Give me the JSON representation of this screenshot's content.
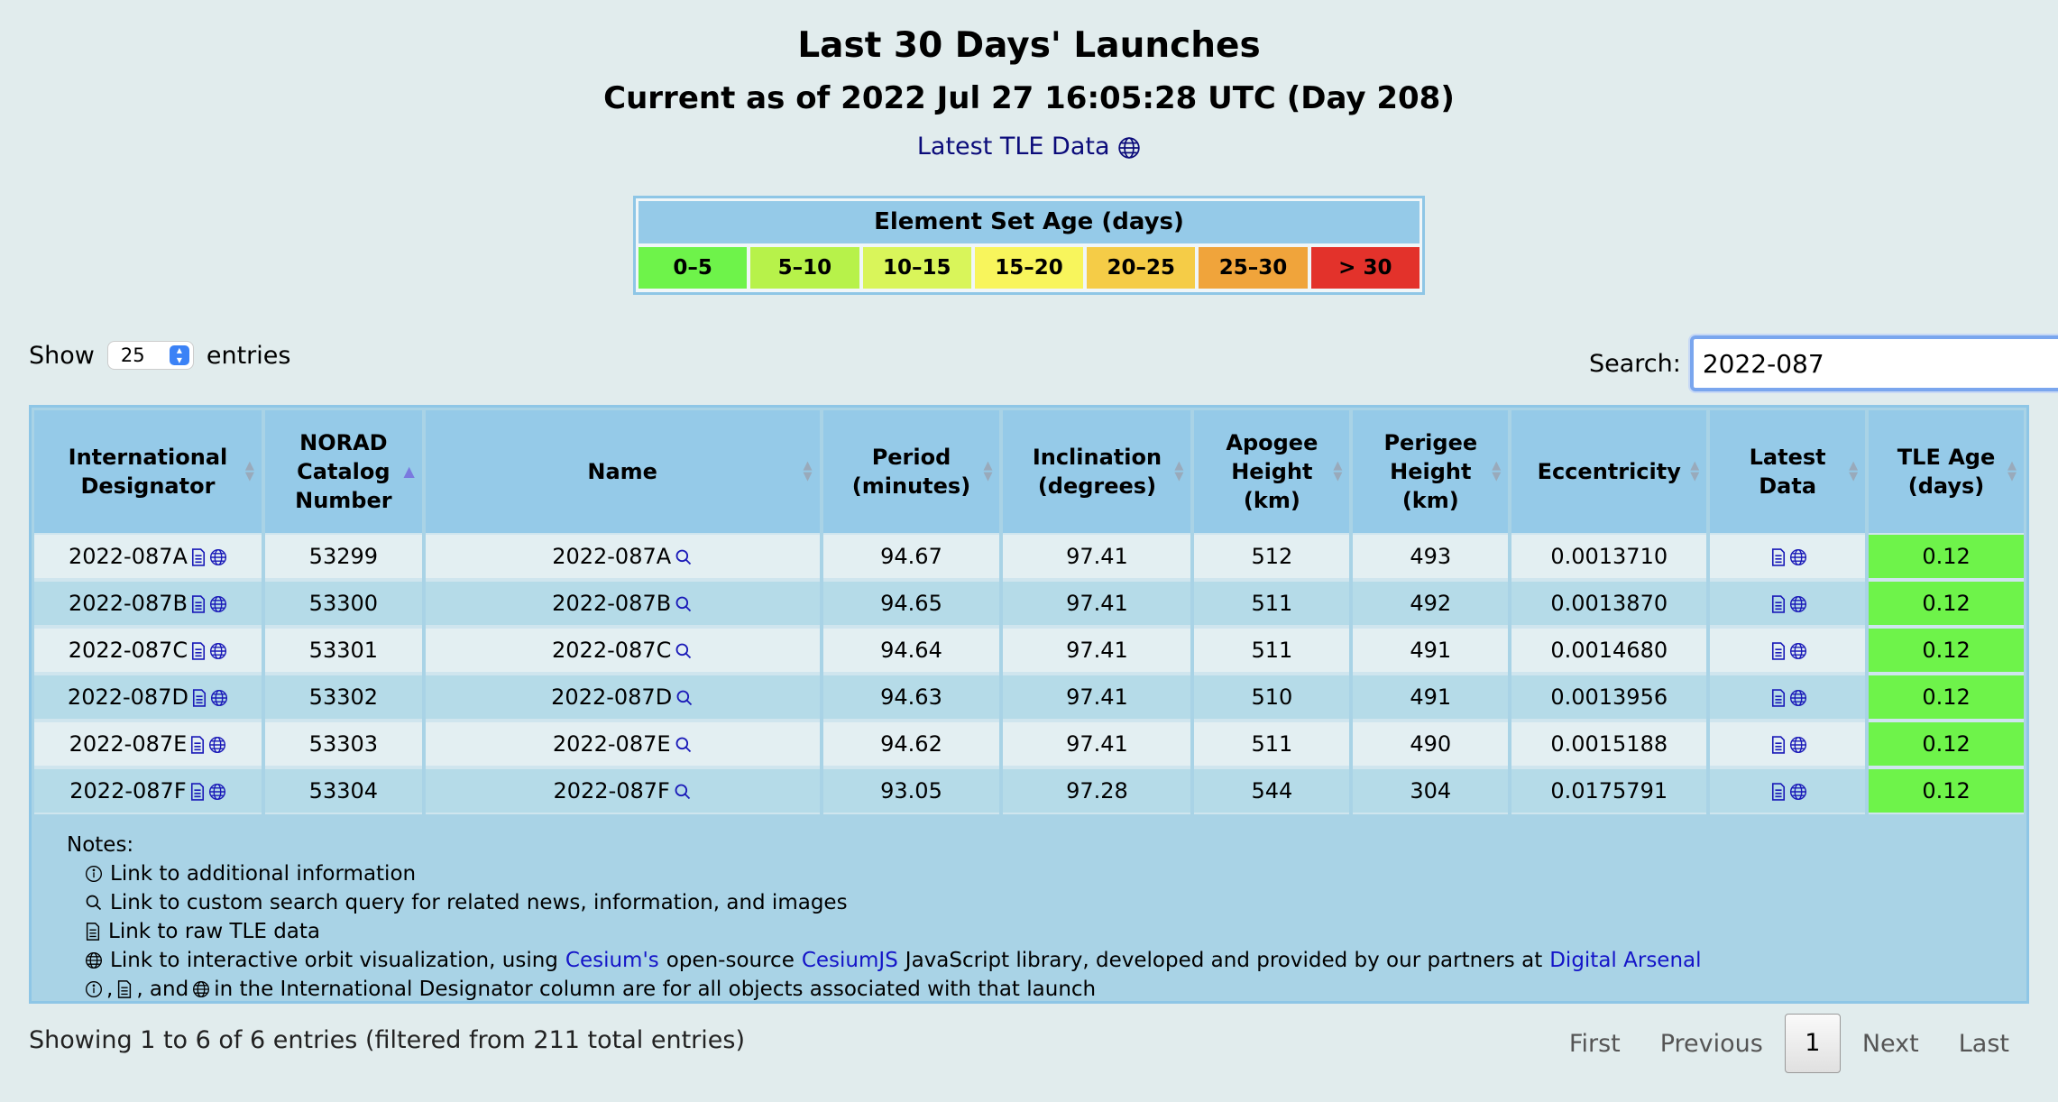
{
  "header": {
    "title": "Last 30 Days' Launches",
    "subtitle": "Current as of 2022 Jul 27 16:05:28 UTC (Day 208)",
    "tle_link": "Latest TLE Data"
  },
  "legend": {
    "title": "Element Set Age (days)",
    "cells": [
      {
        "label": "0–5",
        "color": "#6ef34a"
      },
      {
        "label": "5–10",
        "color": "#b7f24a"
      },
      {
        "label": "10–15",
        "color": "#d9f55a"
      },
      {
        "label": "15–20",
        "color": "#f8f55c"
      },
      {
        "label": "20–25",
        "color": "#f5cc47"
      },
      {
        "label": "25–30",
        "color": "#f0a43b"
      },
      {
        "label": "> 30",
        "color": "#e3322b"
      }
    ]
  },
  "controls": {
    "show_label": "Show",
    "entries_value": "25",
    "entries_label": "entries",
    "search_label": "Search:",
    "search_value": "2022-087"
  },
  "table": {
    "headers": [
      "International Designator",
      "NORAD Catalog Number",
      "Name",
      "Period (minutes)",
      "Inclination (degrees)",
      "Apogee Height (km)",
      "Perigee Height (km)",
      "Eccentricity",
      "Latest Data",
      "TLE Age (days)"
    ],
    "rows": [
      {
        "designator": "2022-087A",
        "norad": "53299",
        "name": "2022-087A",
        "period": "94.67",
        "inclination": "97.41",
        "apogee": "512",
        "perigee": "493",
        "eccentricity": "0.0013710",
        "age": "0.12"
      },
      {
        "designator": "2022-087B",
        "norad": "53300",
        "name": "2022-087B",
        "period": "94.65",
        "inclination": "97.41",
        "apogee": "511",
        "perigee": "492",
        "eccentricity": "0.0013870",
        "age": "0.12"
      },
      {
        "designator": "2022-087C",
        "norad": "53301",
        "name": "2022-087C",
        "period": "94.64",
        "inclination": "97.41",
        "apogee": "511",
        "perigee": "491",
        "eccentricity": "0.0014680",
        "age": "0.12"
      },
      {
        "designator": "2022-087D",
        "norad": "53302",
        "name": "2022-087D",
        "period": "94.63",
        "inclination": "97.41",
        "apogee": "510",
        "perigee": "491",
        "eccentricity": "0.0013956",
        "age": "0.12"
      },
      {
        "designator": "2022-087E",
        "norad": "53303",
        "name": "2022-087E",
        "period": "94.62",
        "inclination": "97.41",
        "apogee": "511",
        "perigee": "490",
        "eccentricity": "0.0015188",
        "age": "0.12"
      },
      {
        "designator": "2022-087F",
        "norad": "53304",
        "name": "2022-087F",
        "period": "93.05",
        "inclination": "97.28",
        "apogee": "544",
        "perigee": "304",
        "eccentricity": "0.0175791",
        "age": "0.12"
      }
    ]
  },
  "notes": {
    "title": "Notes:",
    "info_text": "Link to additional information",
    "search_text": "Link to custom search query for related news, information, and images",
    "raw_text": "Link to raw TLE data",
    "orbit_text_1": "Link to interactive orbit visualization, using",
    "cesium_link": "Cesium's",
    "orbit_text_2": "open-source",
    "cesiumjs_link": "CesiumJS",
    "orbit_text_3": "JavaScript library, developed and provided by our partners at",
    "arsenal_link": "Digital Arsenal",
    "sep1": ",",
    "sep2": ", and",
    "launch_text": "in the International Designator column are for all objects associated with that launch"
  },
  "footer": {
    "info": "Showing 1 to 6 of 6 entries (filtered from 211 total entries)",
    "first": "First",
    "previous": "Previous",
    "page": "1",
    "next": "Next",
    "last": "Last"
  }
}
